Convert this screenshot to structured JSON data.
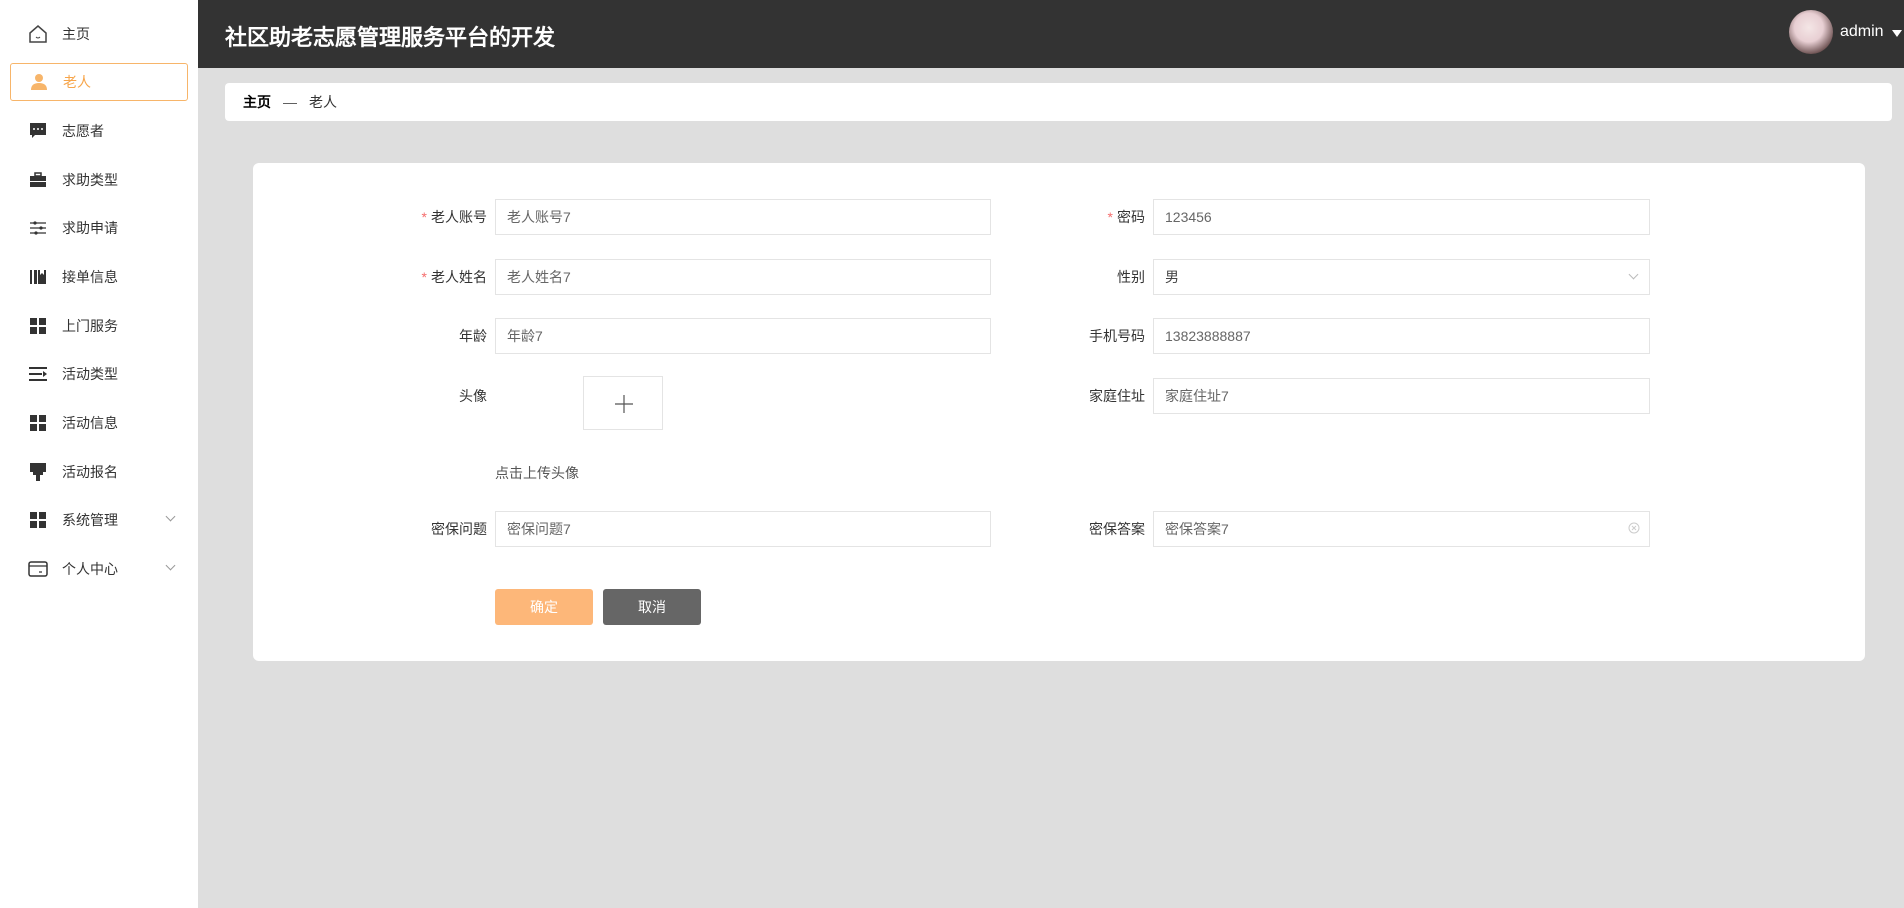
{
  "header": {
    "title": "社区助老志愿管理服务平台的开发",
    "user": "admin"
  },
  "sidebar": {
    "items": [
      {
        "label": "主页",
        "icon": "home-icon"
      },
      {
        "label": "老人",
        "icon": "user-icon",
        "active": true
      },
      {
        "label": "志愿者",
        "icon": "chat-icon"
      },
      {
        "label": "求助类型",
        "icon": "briefcase-icon"
      },
      {
        "label": "求助申请",
        "icon": "sliders-icon"
      },
      {
        "label": "接单信息",
        "icon": "books-icon"
      },
      {
        "label": "上门服务",
        "icon": "grid-icon"
      },
      {
        "label": "活动类型",
        "icon": "list-icon"
      },
      {
        "label": "活动信息",
        "icon": "grid-icon"
      },
      {
        "label": "活动报名",
        "icon": "brush-icon"
      },
      {
        "label": "系统管理",
        "icon": "grid-icon",
        "expandable": true
      },
      {
        "label": "个人中心",
        "icon": "card-icon",
        "expandable": true
      }
    ]
  },
  "breadcrumb": {
    "home": "主页",
    "sep": "—",
    "current": "老人"
  },
  "form": {
    "account": {
      "label": "老人账号",
      "value": "老人账号7"
    },
    "password": {
      "label": "密码",
      "value": "123456"
    },
    "name": {
      "label": "老人姓名",
      "value": "老人姓名7"
    },
    "gender": {
      "label": "性别",
      "value": "男"
    },
    "age": {
      "label": "年龄",
      "value": "年龄7"
    },
    "phone": {
      "label": "手机号码",
      "value": "13823888887"
    },
    "avatar": {
      "label": "头像",
      "hint": "点击上传头像"
    },
    "address": {
      "label": "家庭住址",
      "value": "家庭住址7"
    },
    "question": {
      "label": "密保问题",
      "value": "密保问题7"
    },
    "answer": {
      "label": "密保答案",
      "value": "密保答案7"
    },
    "required_mark": "*",
    "confirm": "确定",
    "cancel": "取消"
  },
  "colors": {
    "accent": "#f7b56a",
    "header": "#333333",
    "cancel": "#666666"
  }
}
